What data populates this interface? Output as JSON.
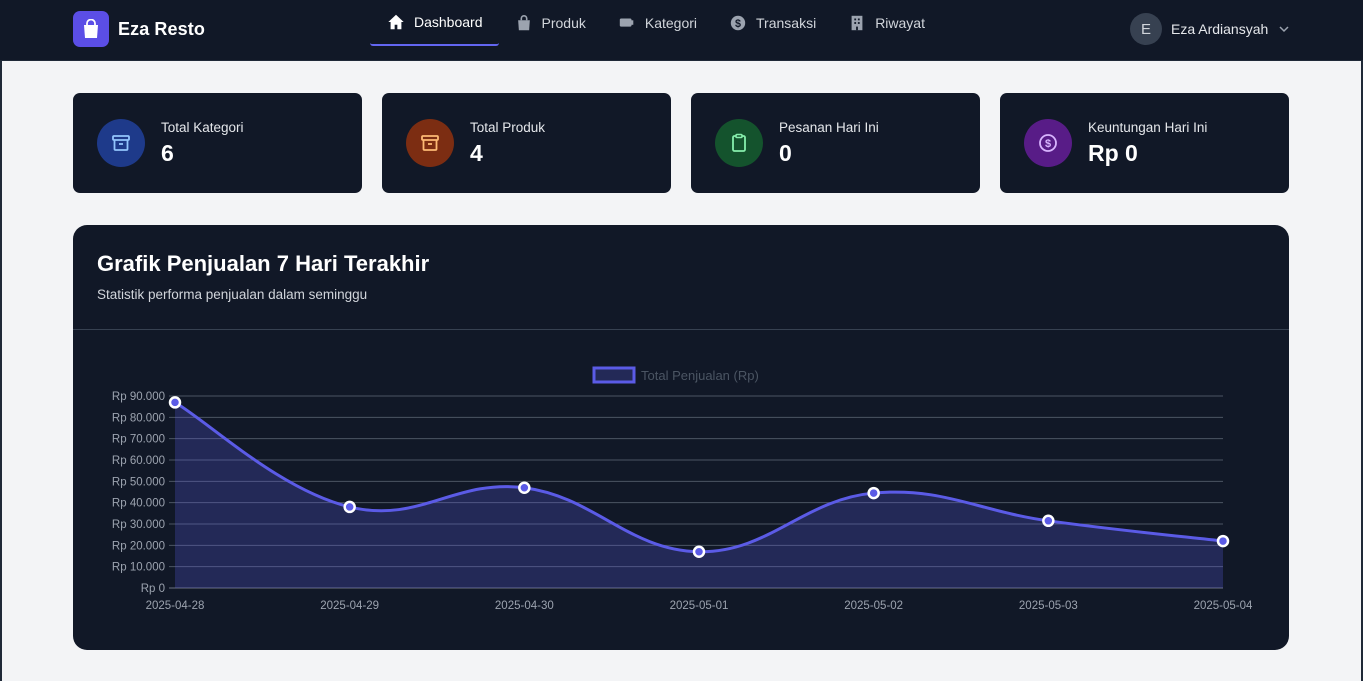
{
  "brand": {
    "name": "Eza Resto"
  },
  "nav": [
    {
      "label": "Dashboard",
      "icon": "home-icon",
      "active": true
    },
    {
      "label": "Produk",
      "icon": "shopping-bag-icon",
      "active": false
    },
    {
      "label": "Kategori",
      "icon": "tag-icon",
      "active": false
    },
    {
      "label": "Transaksi",
      "icon": "dollar-icon",
      "active": false
    },
    {
      "label": "Riwayat",
      "icon": "building-icon",
      "active": false
    }
  ],
  "user": {
    "initial": "E",
    "name": "Eza Ardiansyah"
  },
  "stats": [
    {
      "label": "Total Kategori",
      "value": "6",
      "icon": "archive-icon",
      "color": "#1e3a8a",
      "fg": "#93c5fd"
    },
    {
      "label": "Total Produk",
      "value": "4",
      "icon": "archive-icon",
      "color": "#7c2d12",
      "fg": "#fdba74"
    },
    {
      "label": "Pesanan Hari Ini",
      "value": "0",
      "icon": "clipboard-icon",
      "color": "#14532d",
      "fg": "#86efac"
    },
    {
      "label": "Keuntungan Hari Ini",
      "value": "Rp 0",
      "icon": "dollar-circle-icon",
      "color": "#581c87",
      "fg": "#d8b4fe"
    }
  ],
  "chart_panel": {
    "title": "Grafik Penjualan 7 Hari Terakhir",
    "subtitle": "Statistik performa penjualan dalam seminggu"
  },
  "chart_data": {
    "type": "line",
    "categories": [
      "2025-04-28",
      "2025-04-29",
      "2025-04-30",
      "2025-05-01",
      "2025-05-02",
      "2025-05-03",
      "2025-05-04"
    ],
    "series": [
      {
        "name": "Total Penjualan (Rp)",
        "values": [
          87000,
          38000,
          47000,
          17000,
          44500,
          31500,
          22000
        ],
        "color": "#5b5be6"
      }
    ],
    "ylim": [
      0,
      90000
    ],
    "yticks": [
      0,
      10000,
      20000,
      30000,
      40000,
      50000,
      60000,
      70000,
      80000,
      90000
    ],
    "ytick_labels": [
      "Rp 0",
      "Rp 10.000",
      "Rp 20.000",
      "Rp 30.000",
      "Rp 40.000",
      "Rp 50.000",
      "Rp 60.000",
      "Rp 70.000",
      "Rp 80.000",
      "Rp 90.000"
    ],
    "fill": true,
    "grid": true,
    "legend": "top-center"
  }
}
